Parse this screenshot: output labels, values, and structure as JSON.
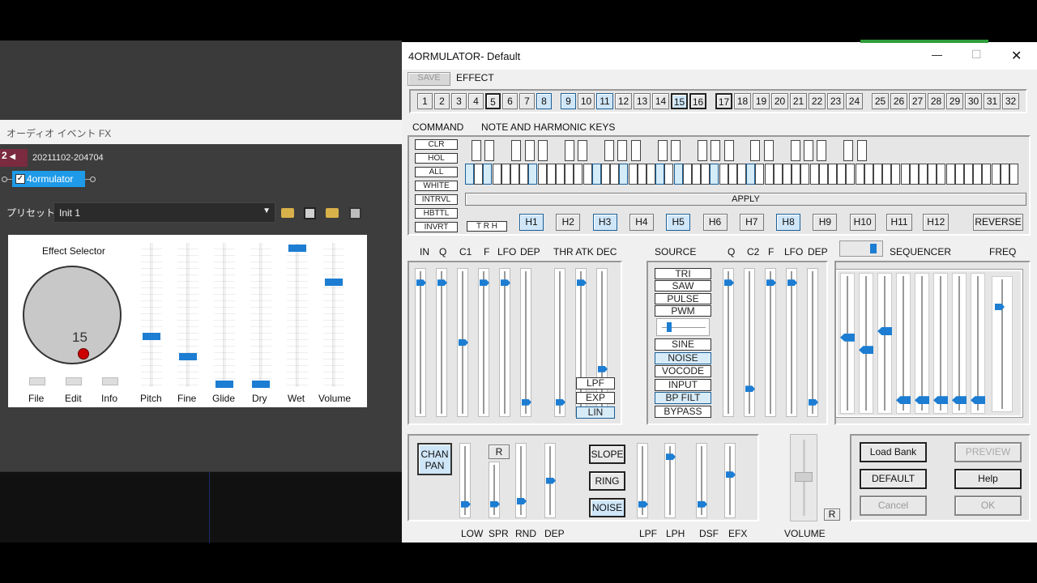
{
  "host": {
    "panel_title": "オーディオ イベント FX",
    "track_number": "2",
    "event_name": "20211102-204704",
    "plugin_chip": "4ormulator",
    "preset_label": "プリセット:",
    "preset_value": "Init 1",
    "selector_title": "Effect Selector",
    "knob_value": "15",
    "small_buttons": [
      "File",
      "Edit",
      "Info"
    ],
    "slider_labels": [
      "Pitch",
      "Fine",
      "Glide",
      "Dry",
      "Wet",
      "Volume"
    ],
    "slider_levels": [
      0.35,
      0.2,
      0.0,
      0.0,
      1.0,
      0.75
    ]
  },
  "window": {
    "title": "4ORMULATOR- Default",
    "minimize_glyph": "—",
    "maximize_glyph": "☐",
    "close_glyph": "✕",
    "save_label": "SAVE",
    "effect_label": "EFFECT",
    "effect_numbers": [
      "1",
      "2",
      "3",
      "4",
      "5",
      "6",
      "7",
      "8",
      "9",
      "10",
      "11",
      "12",
      "13",
      "14",
      "15",
      "16",
      "17",
      "18",
      "19",
      "20",
      "21",
      "22",
      "23",
      "24",
      "25",
      "26",
      "27",
      "28",
      "29",
      "30",
      "31",
      "32"
    ],
    "effect_selected": 15,
    "effect_highlighted": [
      8,
      9,
      11,
      15
    ]
  },
  "command": {
    "section_label": "COMMAND",
    "keys_label": "NOTE AND HARMONIC KEYS",
    "buttons": [
      "CLR",
      "HOL",
      "ALL",
      "WHITE",
      "INTRVL",
      "HBTTL",
      "INVRT"
    ],
    "trh_label": "T R H",
    "apply_label": "APPLY",
    "harmonics": [
      "H1",
      "H2",
      "H3",
      "H4",
      "H5",
      "H6",
      "H7",
      "H8",
      "H9",
      "H10",
      "H11",
      "H12"
    ],
    "harmonics_on": [
      "H1",
      "H3",
      "H5",
      "H8"
    ],
    "reverse_label": "REVERSE"
  },
  "filters": {
    "labels": [
      "IN",
      "Q",
      "C1",
      "F",
      "LFO",
      "DEP"
    ],
    "levels": [
      0.95,
      0.95,
      0.5,
      0.95,
      0.95,
      0.05
    ],
    "env_label": "THR ATK DEC",
    "env_levels": [
      0.05,
      0.95,
      0.3
    ],
    "env_buttons": [
      "LPF",
      "EXP",
      "LIN"
    ],
    "env_on": "LIN"
  },
  "source": {
    "label": "SOURCE",
    "waves": [
      "TRI",
      "SAW",
      "PULSE",
      "PWM"
    ],
    "modes": [
      "SINE",
      "NOISE",
      "VOCODE",
      "INPUT",
      "BP FILT",
      "BYPASS"
    ],
    "modes_on": [
      "NOISE",
      "BP FILT"
    ],
    "sliders": [
      "Q",
      "C2",
      "F",
      "LFO",
      "DEP"
    ],
    "slider_levels": [
      0.95,
      0.15,
      0.95,
      0.95,
      0.05
    ],
    "sequencer_label": "SEQUENCER",
    "freq_label": "FREQ",
    "sequencer_levels": [
      0.55,
      0.45,
      0.6,
      0.05,
      0.05,
      0.05,
      0.05,
      0.05
    ],
    "freq_level": 0.8
  },
  "bottom": {
    "chan_pan": "CHAN PAN",
    "r_label": "R",
    "left_sliders": [
      "LOW",
      "SPR",
      "RND",
      "DEP"
    ],
    "left_levels": [
      0.1,
      0.15,
      0.15,
      0.5
    ],
    "mode_buttons": [
      "SLOPE",
      "RING",
      "NOISE"
    ],
    "mode_on": "NOISE",
    "right_sliders": [
      "LPF",
      "LPH",
      "DSF",
      "EFX"
    ],
    "right_levels": [
      0.1,
      0.9,
      0.1,
      0.6
    ],
    "volume_label": "VOLUME",
    "volume_level": 0.55,
    "vol_r": "R",
    "load_bank": "Load Bank",
    "preview": "PREVIEW",
    "default": "DEFAULT",
    "help": "Help",
    "cancel": "Cancel",
    "ok": "OK"
  },
  "colors": {
    "accent": "#1c7dd2",
    "selected_fill": "#cfe6f8",
    "host_bg": "#3d3d3d"
  }
}
